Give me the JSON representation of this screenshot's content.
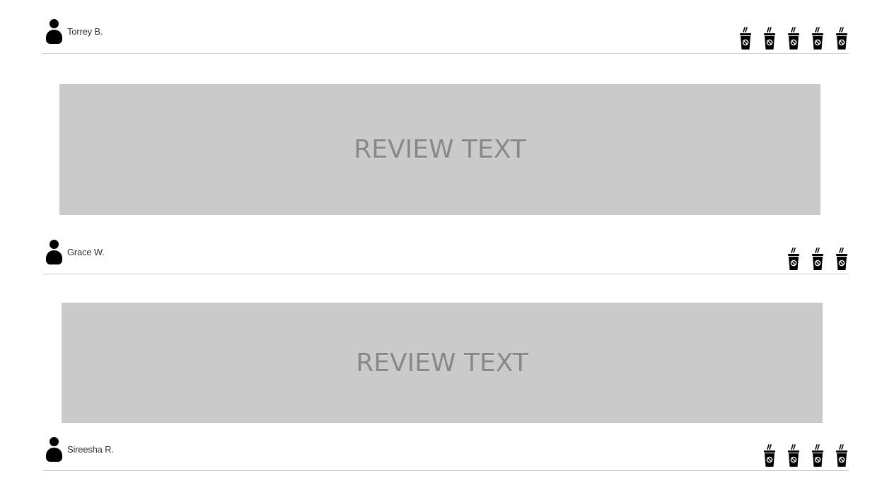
{
  "reviews": [
    {
      "user_name": "Torrey B.",
      "rating": 5
    },
    {
      "user_name": "Grace W.",
      "rating": 3,
      "text": "REVIEW TEXT"
    },
    {
      "user_name": "Sireesha R.",
      "rating": 4
    }
  ],
  "placeholders": [
    {
      "text": "REVIEW TEXT"
    },
    {
      "text": "REVIEW TEXT"
    }
  ],
  "rating_icon": "coffee-cup-icon",
  "colors": {
    "placeholder_bg": "#cacaca",
    "placeholder_text": "#888888",
    "divider": "#c8c8c8",
    "icon": "#000000"
  }
}
